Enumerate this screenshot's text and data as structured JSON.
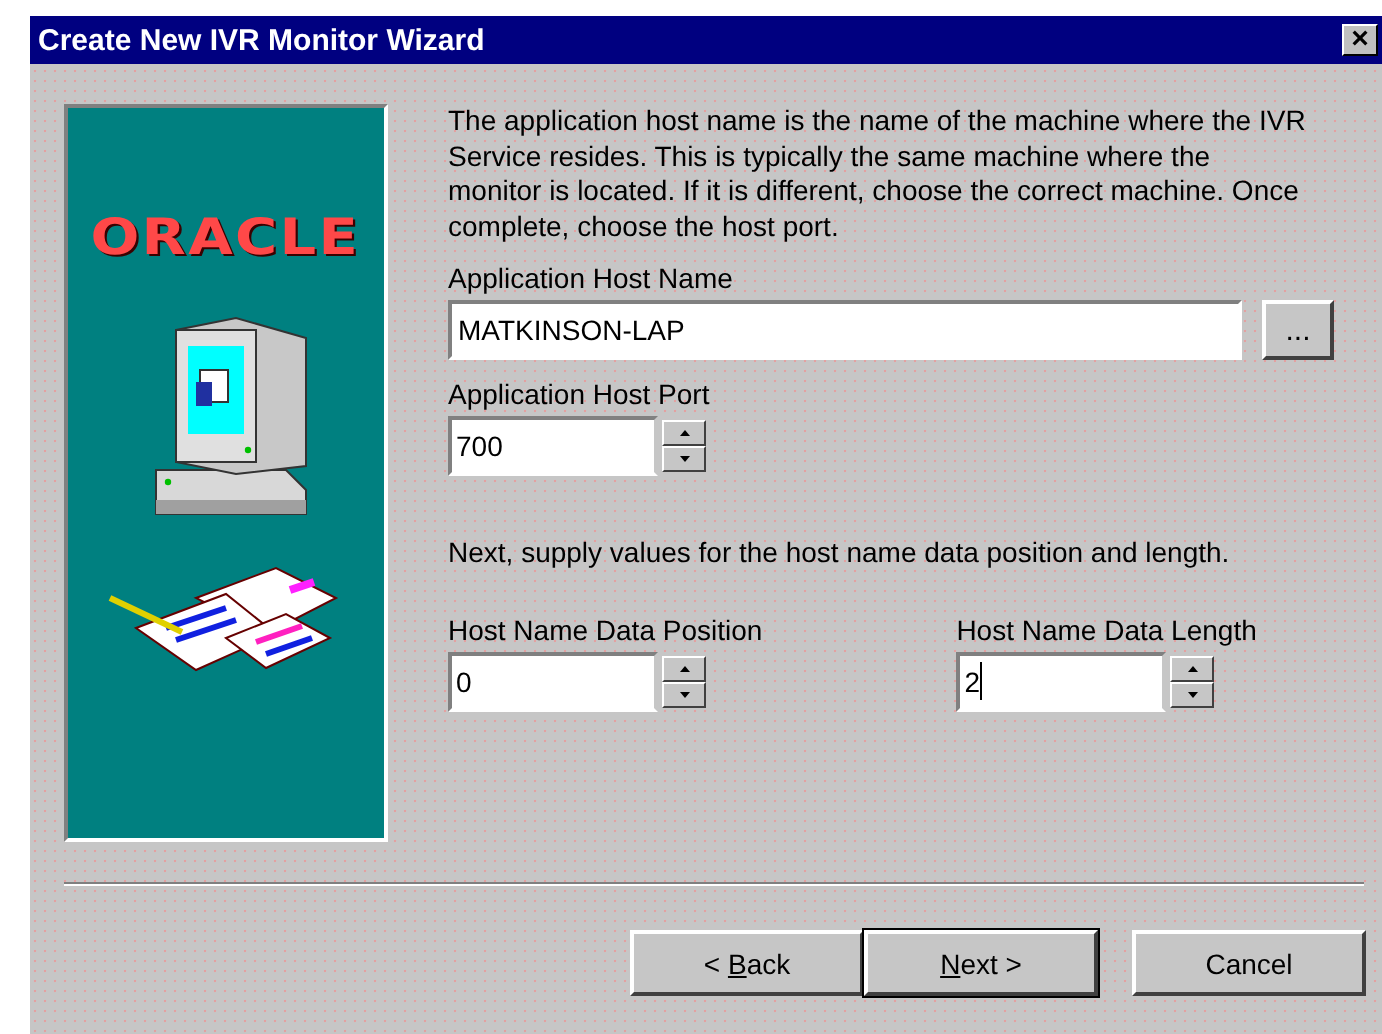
{
  "window": {
    "title": "Create New IVR Monitor Wizard",
    "close_glyph": "×"
  },
  "sidebar": {
    "logo": "ORACLE"
  },
  "intro": "The application host name is the name of the machine where the IVR Service resides.  This is typically the same machine where the monitor is located.  If it is different, choose the correct machine.  Once complete, choose the host port.",
  "host_name": {
    "label": "Application Host Name",
    "value": "MATKINSON-LAP",
    "browse": "..."
  },
  "host_port": {
    "label": "Application Host Port",
    "value": "700"
  },
  "data_note": "Next, supply values for the host name data position and length.",
  "data_fields": [
    {
      "label": "Host Name Data Position",
      "value": "0",
      "focused": false
    },
    {
      "label": "Host Name Data Length",
      "value": "2",
      "focused": true
    }
  ],
  "buttons": [
    {
      "before": "< ",
      "key": "B",
      "after": "ack",
      "default": false
    },
    {
      "key": "N",
      "after": "ext >",
      "default": true
    },
    {
      "before": "Cancel",
      "default": false
    }
  ]
}
